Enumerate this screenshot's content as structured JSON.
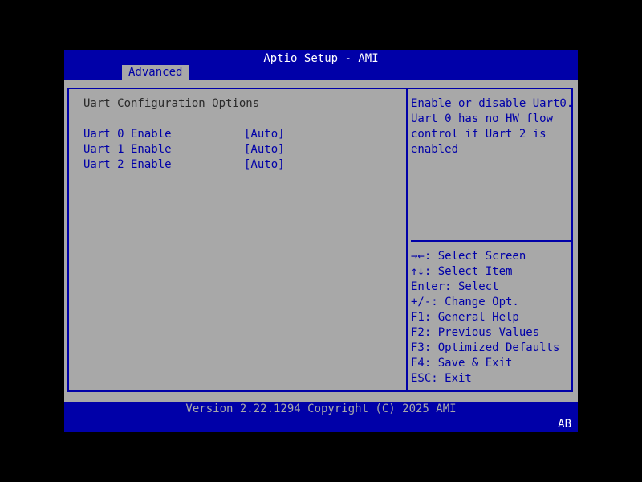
{
  "header": {
    "title": "Aptio Setup - AMI",
    "active_tab": "Advanced"
  },
  "section": {
    "title": "Uart Configuration Options"
  },
  "options": [
    {
      "label": "Uart 0 Enable",
      "value": "[Auto]"
    },
    {
      "label": "Uart 1 Enable",
      "value": "[Auto]"
    },
    {
      "label": "Uart 2 Enable",
      "value": "[Auto]"
    }
  ],
  "help": {
    "lines": [
      "Enable or disable Uart0.",
      "Uart 0 has no HW flow",
      "control if Uart 2 is",
      "enabled"
    ]
  },
  "keys": {
    "lines": [
      "→←: Select Screen",
      "↑↓: Select Item",
      "Enter: Select",
      "+/-: Change Opt.",
      "F1: General Help",
      "F2: Previous Values",
      "F3: Optimized Defaults",
      "F4: Save & Exit",
      "ESC: Exit"
    ]
  },
  "footer": {
    "version": "Version 2.22.1294 Copyright (C) 2025 AMI",
    "badge": "AB"
  },
  "colors": {
    "bios_blue": "#0000a8",
    "panel_gray": "#a8a8a8",
    "background": "#000000",
    "text_white": "#ffffff",
    "text_dark": "#2a2a2a"
  }
}
